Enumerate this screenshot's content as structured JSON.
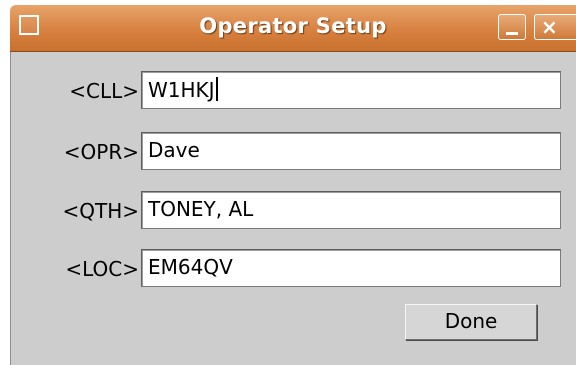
{
  "window": {
    "title": "Operator Setup",
    "close_glyph": "×"
  },
  "fields": [
    {
      "label": "<CLL>",
      "value": "W1HKJ",
      "focused": true
    },
    {
      "label": "<OPR>",
      "value": "Dave",
      "focused": false
    },
    {
      "label": "<QTH>",
      "value": "TONEY, AL",
      "focused": false
    },
    {
      "label": "<LOC>",
      "value": "EM64QV",
      "focused": false
    }
  ],
  "buttons": {
    "done_label": "Done"
  },
  "icons": {
    "window_menu": "window-menu-icon",
    "minimize": "minimize-icon",
    "close": "close-icon"
  },
  "colors": {
    "titlebar": "#d88140",
    "panel": "#cdcdcd",
    "field_bg": "#ffffff"
  }
}
